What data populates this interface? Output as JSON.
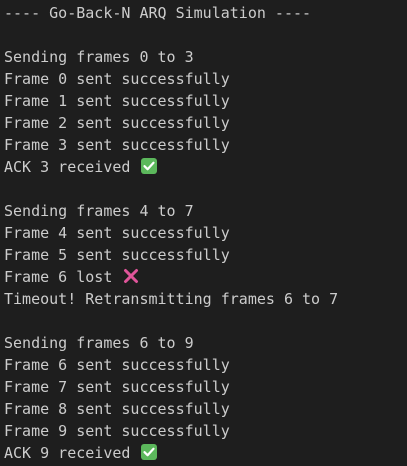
{
  "terminal": {
    "lines": [
      {
        "text": "---- Go-Back-N ARQ Simulation ----"
      },
      {
        "text": ""
      },
      {
        "text": "Sending frames 0 to 3"
      },
      {
        "text": "Frame 0 sent successfully"
      },
      {
        "text": "Frame 1 sent successfully"
      },
      {
        "text": "Frame 2 sent successfully"
      },
      {
        "text": "Frame 3 sent successfully"
      },
      {
        "text": "ACK 3 received",
        "icon": "check-mark-icon"
      },
      {
        "text": ""
      },
      {
        "text": "Sending frames 4 to 7"
      },
      {
        "text": "Frame 4 sent successfully"
      },
      {
        "text": "Frame 5 sent successfully"
      },
      {
        "text": "Frame 6 lost",
        "icon": "cross-mark-icon"
      },
      {
        "text": "Timeout! Retransmitting frames 6 to 7"
      },
      {
        "text": ""
      },
      {
        "text": "Sending frames 6 to 9"
      },
      {
        "text": "Frame 6 sent successfully"
      },
      {
        "text": "Frame 7 sent successfully"
      },
      {
        "text": "Frame 8 sent successfully"
      },
      {
        "text": "Frame 9 sent successfully"
      },
      {
        "text": "ACK 9 received",
        "icon": "check-mark-icon"
      }
    ]
  },
  "colors": {
    "background": "#1e1e1e",
    "text": "#cccccc",
    "check_bg": "#5cb85c",
    "cross": "#e0559a"
  }
}
